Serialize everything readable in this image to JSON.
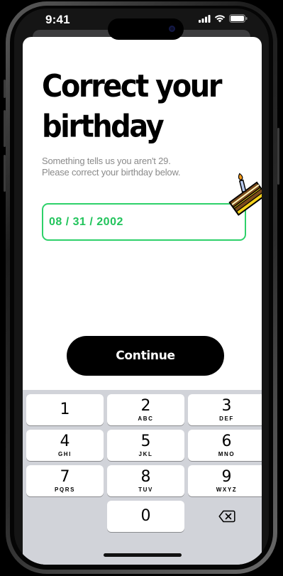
{
  "status_bar": {
    "time": "9:41"
  },
  "screen": {
    "title_line1": "Correct your",
    "title_line2": "birthday",
    "subtitle_line1": "Something tells us you aren't 29.",
    "subtitle_line2": "Please correct your birthday below.",
    "birthday_value": "08 / 31 / 2002",
    "continue_label": "Continue",
    "accent_color": "#2ed16a"
  },
  "keypad": {
    "keys": [
      {
        "digit": "1",
        "letters": ""
      },
      {
        "digit": "2",
        "letters": "ABC"
      },
      {
        "digit": "3",
        "letters": "DEF"
      },
      {
        "digit": "4",
        "letters": "GHI"
      },
      {
        "digit": "5",
        "letters": "JKL"
      },
      {
        "digit": "6",
        "letters": "MNO"
      },
      {
        "digit": "7",
        "letters": "PQRS"
      },
      {
        "digit": "8",
        "letters": "TUV"
      },
      {
        "digit": "9",
        "letters": "WXYZ"
      },
      {
        "digit": "0",
        "letters": ""
      }
    ],
    "delete_icon": "backspace-icon"
  }
}
